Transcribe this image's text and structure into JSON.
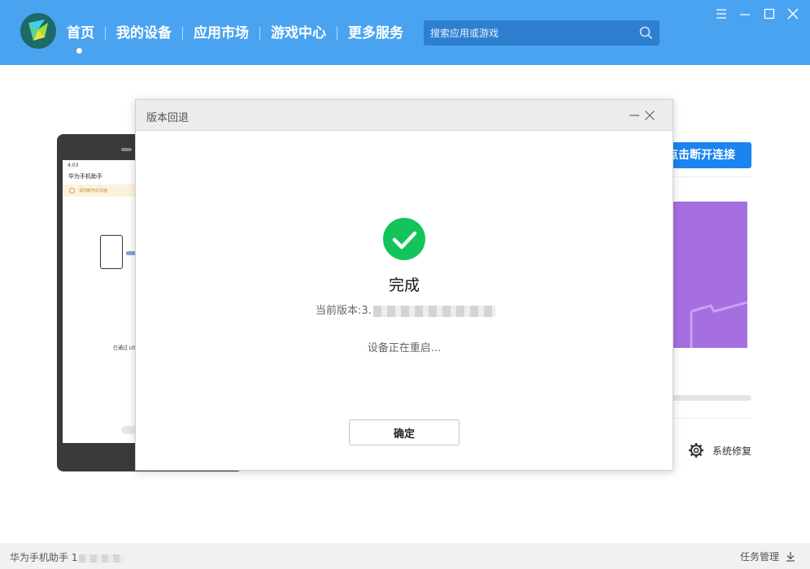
{
  "header": {
    "nav": [
      {
        "label": "首页",
        "active": true
      },
      {
        "label": "我的设备"
      },
      {
        "label": "应用市场"
      },
      {
        "label": "游戏中心"
      },
      {
        "label": "更多服务"
      }
    ],
    "search": {
      "placeholder": "搜索应用或游戏",
      "value": ""
    },
    "window_controls": [
      "menu-icon",
      "minimize-icon",
      "maximize-icon",
      "close-icon"
    ]
  },
  "phone_screen": {
    "time": "4:03",
    "app_title": "华为手机助手",
    "tip": "请勿断开此页面",
    "usb_text": "已通过 USB"
  },
  "main": {
    "disconnect_label": "点击断开连接",
    "repair_label": "系统修复"
  },
  "dialog": {
    "title": "版本回退",
    "done_text": "完成",
    "version_label": "当前版本:3.",
    "status_text": "设备正在重启...",
    "confirm_label": "确定"
  },
  "footer": {
    "app_name": "华为手机助手 1",
    "task_label": "任务管理"
  },
  "colors": {
    "header_bg": "#4aa3f0",
    "accent": "#1a84f0",
    "success": "#14c35a",
    "promo": "#a66fe0"
  }
}
